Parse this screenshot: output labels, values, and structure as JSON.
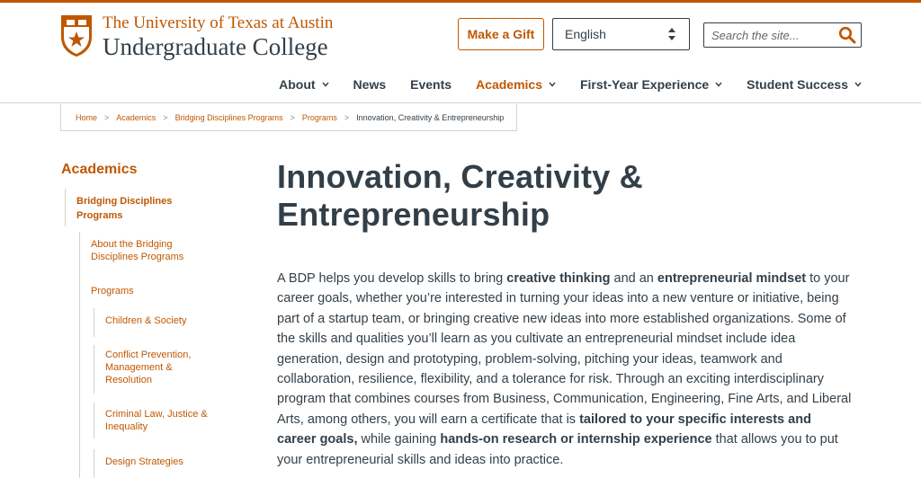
{
  "header": {
    "univ_name": "The University of Texas at Austin",
    "college_name": "Undergraduate College",
    "gift_label": "Make a Gift",
    "language": "English",
    "search_placeholder": "Search the site..."
  },
  "nav": {
    "items": [
      {
        "label": "About",
        "dropdown": true
      },
      {
        "label": "News",
        "dropdown": false
      },
      {
        "label": "Events",
        "dropdown": false
      },
      {
        "label": "Academics",
        "dropdown": true,
        "active": true
      },
      {
        "label": "First-Year Experience",
        "dropdown": true
      },
      {
        "label": "Student Success",
        "dropdown": true
      }
    ]
  },
  "breadcrumb": {
    "items": [
      "Home",
      "Academics",
      "Bridging Disciplines Programs",
      "Programs"
    ],
    "current": "Innovation, Creativity & Entrepreneurship",
    "separator": ">"
  },
  "sidebar": {
    "title": "Academics",
    "level1": "Bridging Disciplines Programs",
    "level2_about": "About the Bridging Disciplines Programs",
    "level2_programs": "Programs",
    "level3": [
      "Children & Society",
      "Conflict Prevention, Management & Resolution",
      "Criminal Law, Justice & Inequality",
      "Design Strategies"
    ]
  },
  "main": {
    "title": "Innovation, Creativity & Entrepreneurship",
    "p1_a": "A BDP helps you develop skills to bring ",
    "p1_b": "creative thinking",
    "p1_c": " and an ",
    "p1_d": "entrepreneurial mindset",
    "p1_e": " to your career goals, whether you’re interested in turning your ideas into a new venture or initiative, being part of a startup team, or bringing creative new ideas into more established organizations. Some of the skills and qualities you’ll learn as you cultivate an entrepreneurial mindset include idea generation, design and prototyping, problem-solving, pitching your ideas, teamwork and collaboration, resilience, flexibility, and a tolerance for risk. Through an exciting interdisciplinary program that combines courses from Business, Communication, Engineering, Fine Arts, and Liberal Arts, among others, you will earn a certificate that is ",
    "p1_f": "tailored to your specific interests and career goals,",
    "p1_g": " while gaining ",
    "p1_h": "hands-on research or internship experience",
    "p1_i": " that allows you to put your entrepreneurial skills and ideas into practice."
  },
  "colors": {
    "burnt_orange": "#bf5700",
    "charcoal": "#333f48",
    "divider": "#d6d2c4"
  },
  "icons": {
    "shield": "ut-shield-icon",
    "search": "search-icon",
    "chevron": "chevron-down-icon",
    "select": "select-arrows-icon"
  }
}
